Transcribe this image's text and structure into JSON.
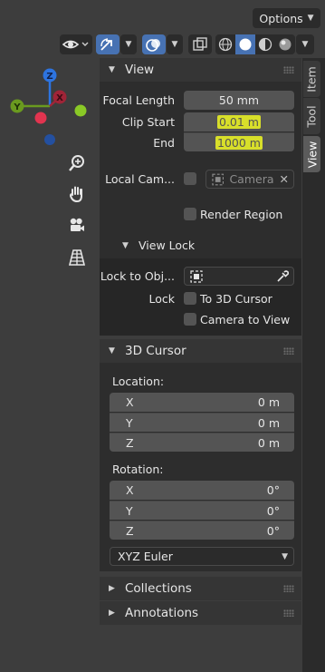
{
  "header": {
    "options_label": "Options",
    "toolbar": [
      {
        "icon": "visibility-eye-icon",
        "dropdown": true
      },
      {
        "icon": "gizmo-arrow-icon",
        "dropdown": true,
        "active": true
      },
      {
        "icon": "overlays-icon",
        "dropdown": true,
        "active": true
      },
      {
        "icon": "xray-icon"
      },
      {
        "icon": "wireframe-shading-icon"
      },
      {
        "icon": "solid-shading-icon",
        "active": true
      },
      {
        "icon": "material-preview-icon"
      },
      {
        "icon": "rendered-shading-icon",
        "dropdown": true
      }
    ]
  },
  "gizmo": {
    "axis_labels": {
      "z": "Z",
      "y": "Y",
      "x": "X"
    },
    "colors": {
      "x": "#e2344f",
      "y": "#8ac926",
      "z": "#2d74e0"
    }
  },
  "nav": [
    "zoom-icon",
    "hand-pan-icon",
    "camera-view-icon",
    "ortho-grid-icon"
  ],
  "view_panel": {
    "title": "View",
    "focal_length_label": "Focal Length",
    "focal_length_value": "50 mm",
    "clip_start_label": "Clip Start",
    "clip_start_value": "0.01 m",
    "clip_end_label": "End",
    "clip_end_value": "1000 m",
    "local_camera_label": "Local Cam...",
    "local_camera_value": "Camera",
    "render_region_label": "Render Region",
    "view_lock_title": "View Lock",
    "lock_to_object_label": "Lock to Obj...",
    "lock_label": "Lock",
    "to_3d_cursor_label": "To 3D Cursor",
    "camera_to_view_label": "Camera to View"
  },
  "cursor_panel": {
    "title": "3D Cursor",
    "location_label": "Location:",
    "location": [
      {
        "axis": "X",
        "value": "0 m"
      },
      {
        "axis": "Y",
        "value": "0 m"
      },
      {
        "axis": "Z",
        "value": "0 m"
      }
    ],
    "rotation_label": "Rotation:",
    "rotation": [
      {
        "axis": "X",
        "value": "0°"
      },
      {
        "axis": "Y",
        "value": "0°"
      },
      {
        "axis": "Z",
        "value": "0°"
      }
    ],
    "rotation_mode": "XYZ Euler"
  },
  "collapsed_panels": [
    "Collections",
    "Annotations"
  ],
  "tabs": [
    {
      "label": "Item",
      "active": false
    },
    {
      "label": "Tool",
      "active": false
    },
    {
      "label": "View",
      "active": true
    }
  ]
}
